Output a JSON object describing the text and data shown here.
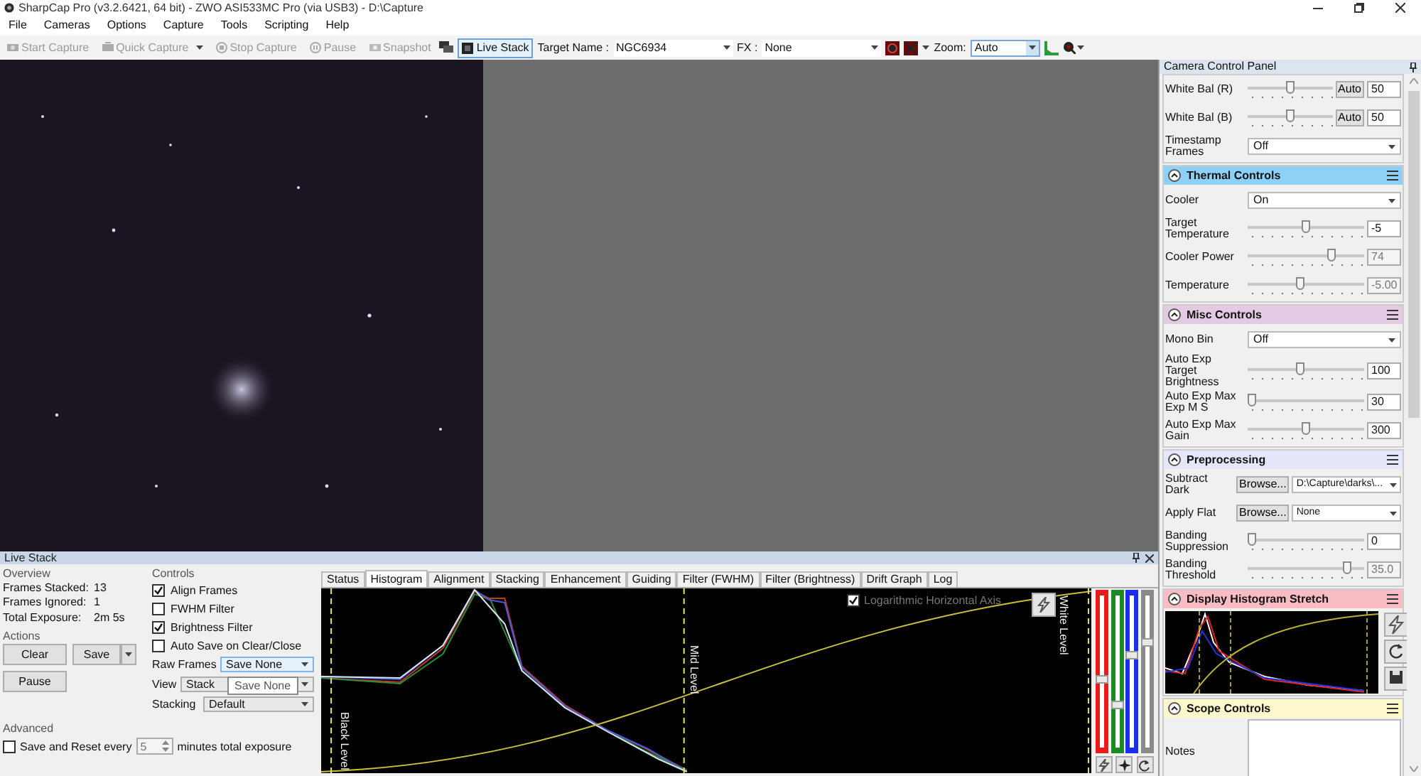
{
  "window": {
    "title": "SharpCap Pro (v3.2.6421, 64 bit) - ZWO ASI533MC Pro (via USB3) - D:\\Capture"
  },
  "menu": [
    "File",
    "Cameras",
    "Options",
    "Capture",
    "Tools",
    "Scripting",
    "Help"
  ],
  "toolbar": {
    "buttons": [
      {
        "label": "Start Capture",
        "disabled": true,
        "dropdown": false
      },
      {
        "label": "Quick Capture",
        "disabled": true,
        "dropdown": true
      },
      {
        "label": "Stop Capture",
        "disabled": true,
        "dropdown": false
      },
      {
        "label": "Pause",
        "disabled": true,
        "dropdown": false
      },
      {
        "label": "Snapshot",
        "disabled": true,
        "dropdown": false
      }
    ],
    "live_stack": {
      "label": "Live Stack",
      "selected": true
    },
    "target": {
      "label": "Target Name :",
      "value": "NGC6934"
    },
    "fx": {
      "label": "FX :",
      "value": "None"
    },
    "zoom": {
      "label": "Zoom:",
      "value": "Auto"
    }
  },
  "camera_panel": {
    "title": "Camera Control Panel",
    "sections": [
      {
        "items": [
          {
            "kind": "slider",
            "label": "White Bal (R)",
            "level": 0.5,
            "value": "50",
            "button": "Auto",
            "disabled": false
          },
          {
            "kind": "slider",
            "label": "White Bal (B)",
            "level": 0.5,
            "value": "50",
            "button": "Auto",
            "disabled": false
          },
          {
            "kind": "select",
            "label": "Timestamp Frames",
            "value": "Off"
          }
        ]
      },
      {
        "title": "Thermal Controls",
        "color": "#8fd0f7",
        "items": [
          {
            "kind": "select",
            "label": "Cooler",
            "value": "On"
          },
          {
            "kind": "slider",
            "label": "Target Temperature",
            "level": 0.5,
            "value": "-5",
            "disabled": false
          },
          {
            "kind": "slider",
            "label": "Cooler Power",
            "level": 0.74,
            "value": "74",
            "disabled": true
          },
          {
            "kind": "slider",
            "label": "Temperature",
            "level": 0.45,
            "value": "-5.00",
            "disabled": true
          }
        ]
      },
      {
        "title": "Misc Controls",
        "color": "#e4c9e3",
        "items": [
          {
            "kind": "select",
            "label": "Mono Bin",
            "value": "Off"
          },
          {
            "kind": "slider",
            "label": "Auto Exp Target Brightness",
            "level": 0.45,
            "value": "100",
            "disabled": false
          },
          {
            "kind": "slider",
            "label": "Auto Exp Max Exp M S",
            "level": 0,
            "value": "30",
            "disabled": false
          },
          {
            "kind": "slider",
            "label": "Auto Exp Max Gain",
            "level": 0.5,
            "value": "300",
            "disabled": false
          }
        ]
      },
      {
        "title": "Preprocessing",
        "color": "#e4e7fa",
        "items": [
          {
            "kind": "browse",
            "label": "Subtract Dark",
            "button": "Browse...",
            "value": "D:\\Capture\\darks\\..."
          },
          {
            "kind": "browse",
            "label": "Apply Flat",
            "button": "Browse...",
            "value": "None"
          },
          {
            "kind": "slider",
            "label": "Banding Suppression",
            "level": 0,
            "value": "0",
            "disabled": false
          },
          {
            "kind": "slider",
            "label": "Banding Threshold",
            "level": 0.88,
            "value": "35.0",
            "disabled": true
          }
        ]
      },
      {
        "title": "Display Histogram Stretch",
        "color": "#f9bcc3",
        "items": [
          {
            "kind": "histogram"
          }
        ]
      },
      {
        "title": "Scope Controls",
        "color": "#fdf9cc",
        "items": [
          {
            "kind": "notes",
            "label": "Notes"
          }
        ]
      }
    ]
  },
  "live_stack_panel": {
    "title": "Live Stack",
    "overview": {
      "heading": "Overview",
      "stats": [
        {
          "label": "Frames Stacked:",
          "value": "13"
        },
        {
          "label": "Frames Ignored:",
          "value": "1"
        },
        {
          "label": "Total Exposure:",
          "value": "2m 5s"
        }
      ]
    },
    "actions": {
      "heading": "Actions",
      "clear": "Clear",
      "save": "Save",
      "pause": "Pause"
    },
    "controls": {
      "heading": "Controls",
      "checkboxes": [
        {
          "label": "Align Frames",
          "checked": true
        },
        {
          "label": "FWHM Filter",
          "checked": false
        },
        {
          "label": "Brightness Filter",
          "checked": true
        },
        {
          "label": "Auto Save on Clear/Close",
          "checked": false
        }
      ],
      "selects": [
        {
          "label": "Raw Frames",
          "value": "Save None",
          "highlighted": true
        },
        {
          "label": "View",
          "value": "Stack",
          "highlighted": false
        },
        {
          "label": "Stacking",
          "value": "Default",
          "highlighted": false
        }
      ]
    },
    "tooltip": "Save None",
    "advanced": {
      "heading": "Advanced",
      "label": "Save and Reset every",
      "checked": false,
      "value": "5",
      "suffix": "minutes total exposure"
    },
    "tabs": [
      {
        "label": "Status",
        "selected": false
      },
      {
        "label": "Histogram",
        "selected": true
      },
      {
        "label": "Alignment",
        "selected": false
      },
      {
        "label": "Stacking",
        "selected": false
      },
      {
        "label": "Enhancement",
        "selected": false
      },
      {
        "label": "Guiding",
        "selected": false
      },
      {
        "label": "Filter (FWHM)",
        "selected": false
      },
      {
        "label": "Filter (Brightness)",
        "selected": false
      },
      {
        "label": "Drift Graph",
        "selected": false
      },
      {
        "label": "Log",
        "selected": false
      }
    ],
    "histogram": {
      "log_axis": {
        "label": "Logarithmic Horizontal Axis",
        "checked": true
      },
      "markers": [
        "Black Level",
        "Mid Level",
        "White Level"
      ],
      "channel_sliders": [
        {
          "color": "#e81c1c",
          "level": 0.45
        },
        {
          "color": "#1d8a2a",
          "level": 0.3
        },
        {
          "color": "#1c2ee8",
          "level": 0.6
        },
        {
          "color": "#8a8a8a",
          "level": 0.68
        }
      ]
    }
  }
}
